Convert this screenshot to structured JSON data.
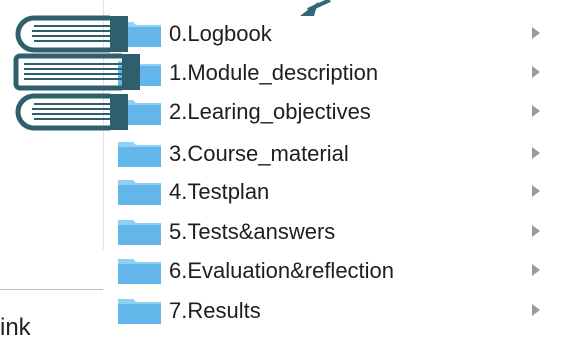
{
  "background": {
    "partial_text": "ink"
  },
  "folders": [
    {
      "label": "0.Logbook"
    },
    {
      "label": "1.Module_description"
    },
    {
      "label": "2.Learing_objectives"
    },
    {
      "label": "3.Course_material"
    },
    {
      "label": "4.Testplan"
    },
    {
      "label": "5.Tests&answers"
    },
    {
      "label": "6.Evaluation&reflection"
    },
    {
      "label": "7.Results"
    }
  ],
  "icons": {
    "folder": "folder-icon",
    "disclosure": "disclosure-triangle-icon",
    "book": "book-icon",
    "arrow": "arrow-icon"
  },
  "colors": {
    "folder_blue": "#63b6ea",
    "folder_blue_light": "#8fd0f5",
    "book_teal": "#2f5f6c",
    "arrow_teal": "#2d6a78",
    "disclosure_gray": "#9a9a9a"
  }
}
